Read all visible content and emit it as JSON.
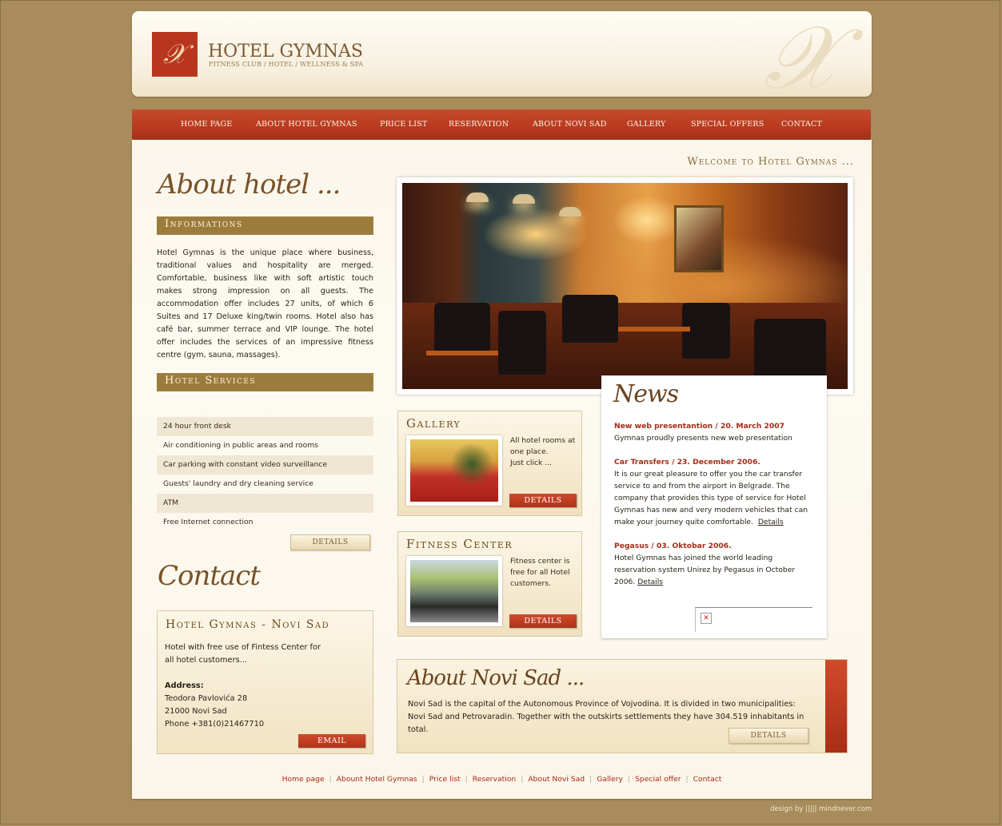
{
  "brand": {
    "logo_glyph": "𝒳",
    "title": "HOTEL GYMNAS",
    "subtitle": "FITNESS CLUB / HOTEL / WELLNESS & SPA",
    "colors": {
      "accent": "#b8361e",
      "gold": "#9c7c3c",
      "background": "#a88c5c"
    }
  },
  "nav": {
    "items": [
      {
        "label": "HOME PAGE"
      },
      {
        "label": "ABOUT HOTEL GYMNAS"
      },
      {
        "label": "PRICE LIST"
      },
      {
        "label": "RESERVATION"
      },
      {
        "label": "ABOUT NOVI SAD"
      },
      {
        "label": "GALLERY"
      },
      {
        "label": "SPECIAL OFFERS"
      },
      {
        "label": "CONTACT"
      }
    ]
  },
  "welcome": "Welcome to Hotel Gymnas ...",
  "about": {
    "title": "About hotel ...",
    "info_heading": "Informations",
    "info_text": "Hotel Gymnas is the unique place where business, traditional values and hospitality are merged. Comfortable, business like with soft artistic touch makes strong impression on all guests. The accommodation offer includes 27 units, of which 6 Suites and 17 Deluxe king/twin rooms. Hotel also has café bar, summer terrace and VIP lounge. The hotel offer includes the services of an impressive fitness centre (gym, sauna, massages).",
    "services_heading": "Hotel Services",
    "services": [
      "24 hour front desk",
      "Air conditioning in public areas and rooms",
      "Car parking with constant video surveillance",
      "Guests' laundry and dry cleaning service",
      "ATM",
      "Free Internet connection"
    ],
    "details_label": "DETAILS"
  },
  "contact": {
    "title": "Contact",
    "box_title": "Hotel Gymnas - Novi Sad",
    "intro_1": "Hotel with free use of Fintess Center for",
    "intro_2": "all hotel customers...",
    "address_label": "Address:",
    "street": "Teodora Pavlovića 28",
    "city": "21000 Novi Sad",
    "phone": "Phone +381(0)21467710",
    "email_label": "EMAIL"
  },
  "gallery": {
    "title": "Gallery",
    "text_1": "All hotel rooms at",
    "text_2": "one place.",
    "text_3": "Just click ...",
    "details_label": "DETAILS"
  },
  "fitness": {
    "title": "Fitness Center",
    "text_1": "Fitness center is",
    "text_2": "free for all Hotel",
    "text_3": "customers.",
    "details_label": "DETAILS"
  },
  "news": {
    "title": "News",
    "items": [
      {
        "head": "New web presentantion / 20. March 2007",
        "body": "Gymnas proudly presents new web presentation",
        "link": ""
      },
      {
        "head": "Car Transfers / 23. December 2006.",
        "body": "It is our great pleasure to offer you the car transfer service to and from the airport in Belgrade.  The company that provides this type of service for Hotel Gymnas has new and very modern vehicles that can make your journey quite comfortable.",
        "link": "Details"
      },
      {
        "head": "Pegasus / 03. Oktobar 2006.",
        "body": "Hotel Gymnas has joined the world leading reservation system Unirez by Pegasus in October 2006.",
        "link": "Details"
      }
    ],
    "broken_image_glyph": "✕"
  },
  "novi_sad": {
    "title": "About Novi Sad ...",
    "text": "Novi Sad is the capital of the Autonomous Province of Vojvodina. It is divided in two municipalities: Novi Sad and Petrovaradin. Together with the outskirts settlements they have 304.519 inhabitants in total.",
    "details_label": "DETAILS"
  },
  "footer": {
    "links": [
      "Home page",
      "Abount Hotel Gymnas",
      "Price list",
      "Reservation",
      "About Novi Sad",
      "Gallery",
      "Special offer",
      "Contact"
    ],
    "separator": "|",
    "credit": "design by  ||||| mindnever.com"
  }
}
